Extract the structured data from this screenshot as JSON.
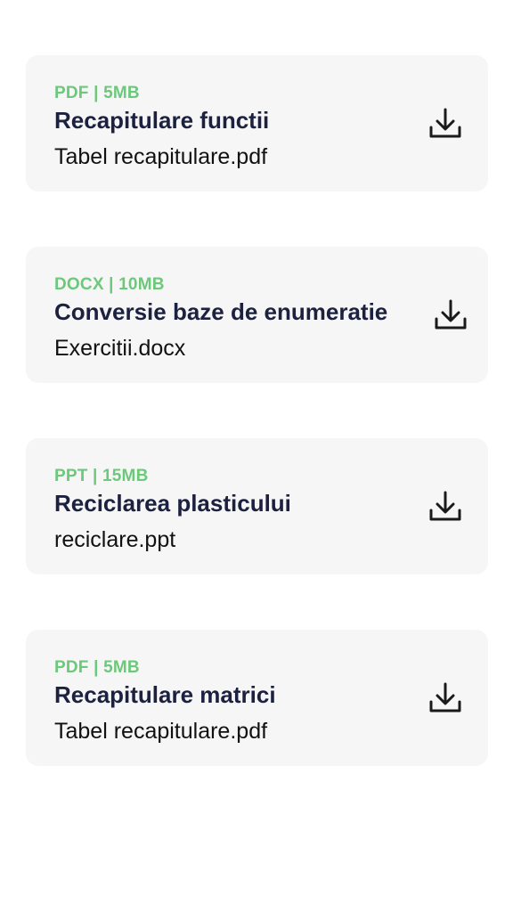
{
  "files": [
    {
      "meta": "PDF | 5MB",
      "title": "Recapitulare functii",
      "filename": "Tabel recapitulare.pdf",
      "icon": "download-icon"
    },
    {
      "meta": "DOCX | 10MB",
      "title": "Conversie baze de enumeratie",
      "filename": "Exercitii.docx",
      "icon": "download-icon"
    },
    {
      "meta": "PPT | 15MB",
      "title": "Reciclarea plasticului",
      "filename": "reciclare.ppt",
      "icon": "download-icon"
    },
    {
      "meta": "PDF | 5MB",
      "title": "Recapitulare matrici",
      "filename": "Tabel recapitulare.pdf",
      "icon": "download-icon"
    }
  ],
  "colors": {
    "meta": "#6cc87a",
    "title": "#1c2140",
    "card_background": "#f6f6f6"
  }
}
